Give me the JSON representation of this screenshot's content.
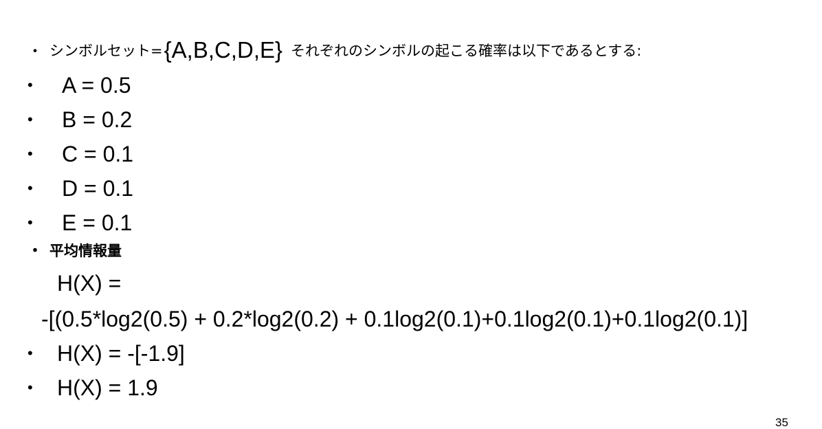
{
  "intro": {
    "bullet": "・",
    "prefix": "シンボルセット=",
    "set": "{A,B,C,D,E}",
    "suffix": "それぞれのシンボルの起こる確率は以下であるとする:"
  },
  "probabilities": [
    {
      "bullet": "•",
      "text": "A = 0.5"
    },
    {
      "bullet": "•",
      "text": "B = 0.2"
    },
    {
      "bullet": "•",
      "text": "C = 0.1"
    },
    {
      "bullet": "•",
      "text": "D = 0.1"
    },
    {
      "bullet": "•",
      "text": "E = 0.1"
    }
  ],
  "entropy": {
    "bullet": "・",
    "heading": "平均情報量",
    "label": "H(X) =",
    "formula": "-[(0.5*log2(0.5) + 0.2*log2(0.2) + 0.1log2(0.1)+0.1log2(0.1)+0.1log2(0.1)]"
  },
  "results": [
    {
      "bullet": "•",
      "text": "H(X) = -[-1.9]"
    },
    {
      "bullet": "•",
      "text": "H(X) = 1.9"
    }
  ],
  "page_number": "35"
}
